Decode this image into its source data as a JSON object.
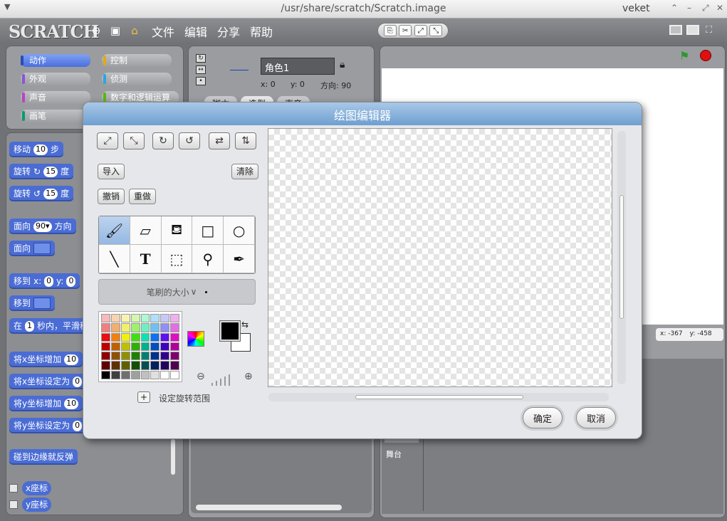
{
  "window": {
    "title": "/usr/share/scratch/Scratch.image",
    "user": "veket"
  },
  "menubar": {
    "logo": "SCRATCH",
    "menus": [
      "文件",
      "编辑",
      "分享",
      "帮助"
    ]
  },
  "categories": [
    {
      "label": "动作",
      "color": "#4a6cd4",
      "selected": true
    },
    {
      "label": "控制",
      "color": "#e1a91a"
    },
    {
      "label": "外观",
      "color": "#8a55d7"
    },
    {
      "label": "侦测",
      "color": "#2ca5e2"
    },
    {
      "label": "声音",
      "color": "#bb42c3"
    },
    {
      "label": "数字和逻辑运算",
      "color": "#5cb712"
    },
    {
      "label": "画笔",
      "color": "#0e9a6c"
    }
  ],
  "blocks": {
    "move": {
      "prefix": "移动",
      "value": "10",
      "suffix": "步"
    },
    "turn_cw": {
      "prefix": "旋转",
      "value": "15",
      "suffix": "度"
    },
    "turn_ccw": {
      "prefix": "旋转",
      "value": "15",
      "suffix": "度"
    },
    "point_dir": {
      "prefix": "面向",
      "value": "90▾",
      "suffix": "方向"
    },
    "point_towards": {
      "prefix": "面向"
    },
    "goto_xy": {
      "prefix": "移到",
      "xlabel": "x:",
      "x": "0",
      "ylabel": "y:",
      "y": "0"
    },
    "goto": {
      "prefix": "移到"
    },
    "glide": {
      "prefix": "在",
      "value": "1",
      "suffix": "秒内，平滑移"
    },
    "change_x": {
      "prefix": "将x坐标增加",
      "value": "10"
    },
    "set_x": {
      "prefix": "将x坐标设定为",
      "value": "0"
    },
    "change_y": {
      "prefix": "将y坐标增加",
      "value": "10"
    },
    "set_y": {
      "prefix": "将y坐标设定为",
      "value": "0"
    },
    "bounce": {
      "label": "碰到边缘就反弹"
    },
    "xpos": {
      "label": "x座标"
    },
    "ypos": {
      "label": "y座标"
    }
  },
  "sprite": {
    "name": "角色1",
    "x_label": "x: 0",
    "y_label": "y: 0",
    "dir_label": "方向: 90",
    "tabs": [
      "脚本",
      "造型",
      "声音"
    ]
  },
  "stage": {
    "coords": {
      "x": "x: -367",
      "y": "y: -458"
    },
    "label": "舞台"
  },
  "paint_editor": {
    "title": "绘图编辑器",
    "import": "导入",
    "clear": "清除",
    "undo": "撤销",
    "redo": "重做",
    "brush_size": "笔刷的大小",
    "set_rotation": "设定旋转范围",
    "ok": "确定",
    "cancel": "取消",
    "fg_color": "#000000",
    "bg_color": "#ffffff",
    "palette": [
      "#f7b9b9",
      "#f7d3b0",
      "#f7f3b0",
      "#d3f7b0",
      "#b0f7d3",
      "#b0e0f7",
      "#c8c8f7",
      "#f0b0f0",
      "#f08080",
      "#f0b070",
      "#f0f070",
      "#a0f070",
      "#70f0c0",
      "#70c0f0",
      "#9090f0",
      "#e070e0",
      "#e81010",
      "#f08010",
      "#f0f010",
      "#40e010",
      "#10e0b0",
      "#1070f0",
      "#6010f0",
      "#e010c0",
      "#c00000",
      "#c06000",
      "#c0c000",
      "#30b000",
      "#00b090",
      "#0050c0",
      "#4000c0",
      "#b0009a",
      "#900000",
      "#905000",
      "#909000",
      "#208000",
      "#008070",
      "#003090",
      "#300090",
      "#800070",
      "#600000",
      "#603000",
      "#606000",
      "#105000",
      "#005050",
      "#002060",
      "#200060",
      "#500050",
      "#000000",
      "#404040",
      "#707070",
      "#a0a0a0",
      "#c0c0c0",
      "#e0e0e0",
      "#ffffff",
      "#ffffff"
    ]
  }
}
